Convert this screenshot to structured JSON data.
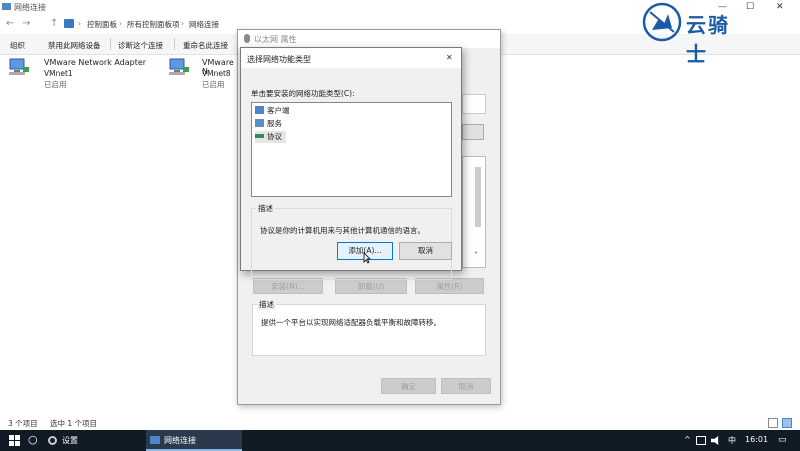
{
  "window": {
    "title": "网络连接",
    "minimize": "—",
    "maximize": "☐",
    "close": "✕"
  },
  "address": {
    "back": "←",
    "forward": "→",
    "up": "↑",
    "crumbs": [
      "控制面板",
      "所有控制面板项",
      "网络连接"
    ],
    "sep": "›"
  },
  "toolbar": {
    "items": [
      "组织",
      "禁用此网络设备",
      "诊断这个连接",
      "重命名此连接"
    ]
  },
  "adapters": [
    {
      "name": "VMware Network Adapter",
      "sub1": "VMnet1",
      "sub2": "已启用"
    },
    {
      "name": "VMware N",
      "sub1": "VMnet8",
      "sub2": "已启用"
    }
  ],
  "status": {
    "count": "3 个项目",
    "selected": "选中 1 个项目"
  },
  "logo": {
    "text": "云骑士"
  },
  "props": {
    "title": "以太网 属性",
    "install": "安装(N)...",
    "uninstall": "卸载(U)",
    "properties": "属性(R)",
    "desc_label": "描述",
    "desc_text": "提供一个平台以实现网络适配器负载平衡和故障转移。",
    "ok": "确定",
    "cancel": "取消",
    "scroll_down": "˅"
  },
  "select_dialog": {
    "title": "选择网络功能类型",
    "close": "✕",
    "prompt": "单击要安装的网络功能类型(C):",
    "items": [
      "客户端",
      "服务",
      "协议"
    ],
    "desc_label": "描述",
    "desc_text": "协议是你的计算机用来与其他计算机通信的语言。",
    "add": "添加(A)...",
    "cancel": "取消"
  },
  "taskbar": {
    "start_icon": "windows-logo",
    "search_icon": "○",
    "settings": "设置",
    "network": "网络连接",
    "tray": "^",
    "ime": "中",
    "time": "16:01",
    "notify": "▭"
  },
  "colors": {
    "taskbar": "#101b26",
    "accent": "#0078d7",
    "logo_blue": "#1a5aa6"
  }
}
